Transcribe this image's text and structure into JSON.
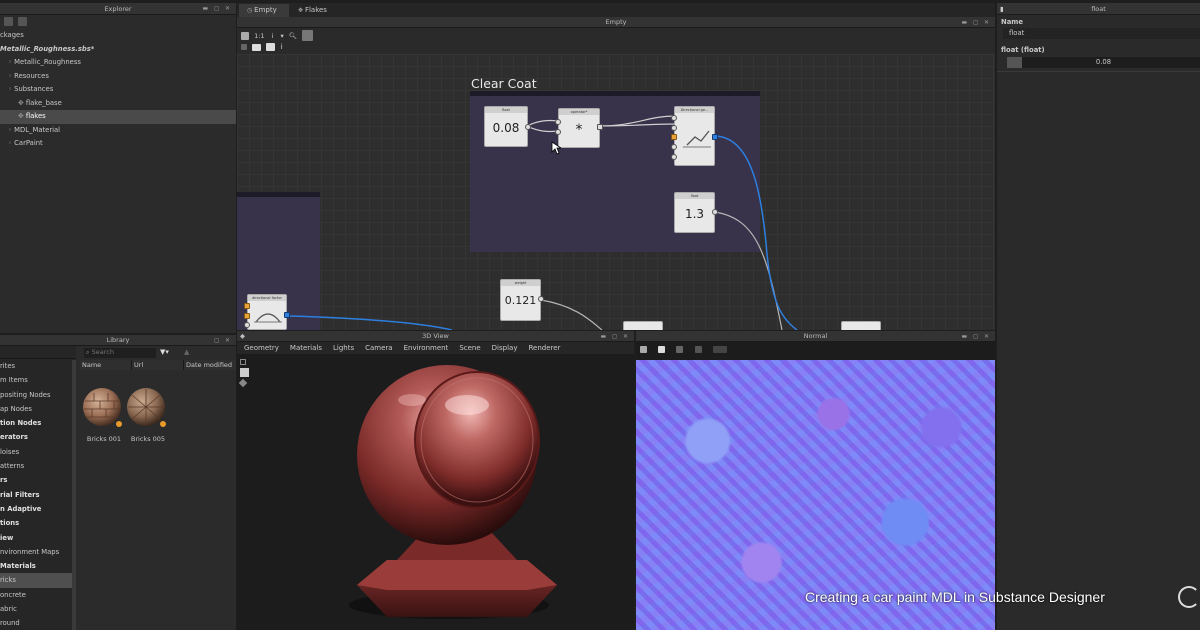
{
  "explorer": {
    "title": "Explorer",
    "items": [
      {
        "label": "ckages",
        "indent": 0,
        "bold": false
      },
      {
        "label": "Metallic_Roughness.sbs*",
        "indent": 0,
        "bold": true
      },
      {
        "label": "Metallic_Roughness",
        "indent": 1,
        "bold": false
      },
      {
        "label": "Resources",
        "indent": 1,
        "bold": false
      },
      {
        "label": "Substances",
        "indent": 1,
        "bold": false
      },
      {
        "label": "flake_base",
        "indent": 2,
        "bold": false
      },
      {
        "label": "flakes",
        "indent": 2,
        "bold": false,
        "selected": true
      },
      {
        "label": "MDL_Material",
        "indent": 1,
        "bold": false
      },
      {
        "label": "CarPaint",
        "indent": 1,
        "bold": false
      }
    ]
  },
  "graph": {
    "tabs": [
      {
        "label": "Empty"
      },
      {
        "label": "Flakes"
      }
    ],
    "title": "Empty",
    "toolbar_zoom": "1:1",
    "frame_title": "Clear Coat",
    "nodes": {
      "float_a": {
        "head": "float",
        "value": "0.08"
      },
      "multiply": {
        "head": "operator*",
        "value": "*"
      },
      "fresnel": {
        "head": "Directional ge..."
      },
      "float_b": {
        "head": "float",
        "value": "1.3"
      },
      "weight": {
        "head": "weight",
        "value": "0.121"
      },
      "directional": {
        "head": "directional factor"
      }
    }
  },
  "properties": {
    "title": "float",
    "name_label": "Name",
    "name_value": "float",
    "section": "float (float)",
    "slider_value": "0.08"
  },
  "library": {
    "title": "Library",
    "search_placeholder": "Search",
    "columns": [
      "Name",
      "Url",
      "Date modified"
    ],
    "categories": [
      {
        "label": "rites",
        "bold": false
      },
      {
        "label": "m Items",
        "bold": false
      },
      {
        "label": "positing Nodes",
        "bold": false
      },
      {
        "label": "ap Nodes",
        "bold": false
      },
      {
        "label": "tion Nodes",
        "bold": true
      },
      {
        "label": "erators",
        "bold": true
      },
      {
        "label": "loises",
        "bold": false
      },
      {
        "label": "atterns",
        "bold": false
      },
      {
        "label": "rs",
        "bold": true
      },
      {
        "label": "rial Filters",
        "bold": true
      },
      {
        "label": "n Adaptive",
        "bold": true
      },
      {
        "label": "tions",
        "bold": true
      },
      {
        "label": "iew",
        "bold": true
      },
      {
        "label": "nvironment Maps",
        "bold": false
      },
      {
        "label": "Materials",
        "bold": true
      },
      {
        "label": "ricks",
        "bold": false,
        "selected": true
      },
      {
        "label": "oncrete",
        "bold": false
      },
      {
        "label": "abric",
        "bold": false
      },
      {
        "label": "round",
        "bold": false
      }
    ],
    "thumbs": [
      {
        "label": "Bricks 001"
      },
      {
        "label": "Bricks 005"
      }
    ]
  },
  "view3d": {
    "title": "3D View",
    "menu": [
      "Geometry",
      "Materials",
      "Lights",
      "Camera",
      "Environment",
      "Scene",
      "Display",
      "Renderer"
    ]
  },
  "normal_view": {
    "title": "Normal"
  },
  "caption": "Creating a car paint MDL in Substance Designer",
  "colors": {
    "paint": "#8e2f2f",
    "frame": "#38324a",
    "wire_blue": "#2d7fe0"
  }
}
